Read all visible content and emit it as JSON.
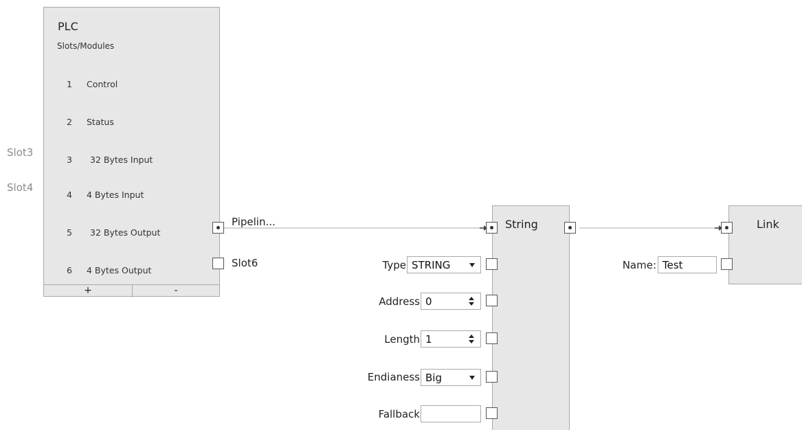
{
  "plc": {
    "title": "PLC",
    "subtitle": "Slots/Modules",
    "slots": [
      {
        "num": "1",
        "label": "Control"
      },
      {
        "num": "2",
        "label": "Status"
      },
      {
        "num": "3",
        "label": "32 Bytes Input"
      },
      {
        "num": "4",
        "label": "4 Bytes Input"
      },
      {
        "num": "5",
        "label": "32 Bytes Output"
      },
      {
        "num": "6",
        "label": "4 Bytes Output"
      }
    ],
    "add_label": "+",
    "remove_label": "-",
    "external_slots": {
      "slot3": "Slot3",
      "slot4": "Slot4"
    },
    "outputs": {
      "slot5": "Pipelin...",
      "slot6": "Slot6"
    }
  },
  "string_node": {
    "title": "String",
    "props": {
      "type_label": "Type",
      "type_value": "STRING",
      "address_label": "Address",
      "address_value": "0",
      "length_label": "Length",
      "length_value": "1",
      "endianess_label": "Endianess",
      "endianess_value": "Big",
      "fallback_label": "Fallback",
      "fallback_value": ""
    }
  },
  "link_node": {
    "title": "Link",
    "name_label": "Name:",
    "name_value": "Test"
  },
  "colors": {
    "node_bg": "#e7e7e7",
    "node_border": "#a9a9a9",
    "wire": "#d5d5d5"
  }
}
